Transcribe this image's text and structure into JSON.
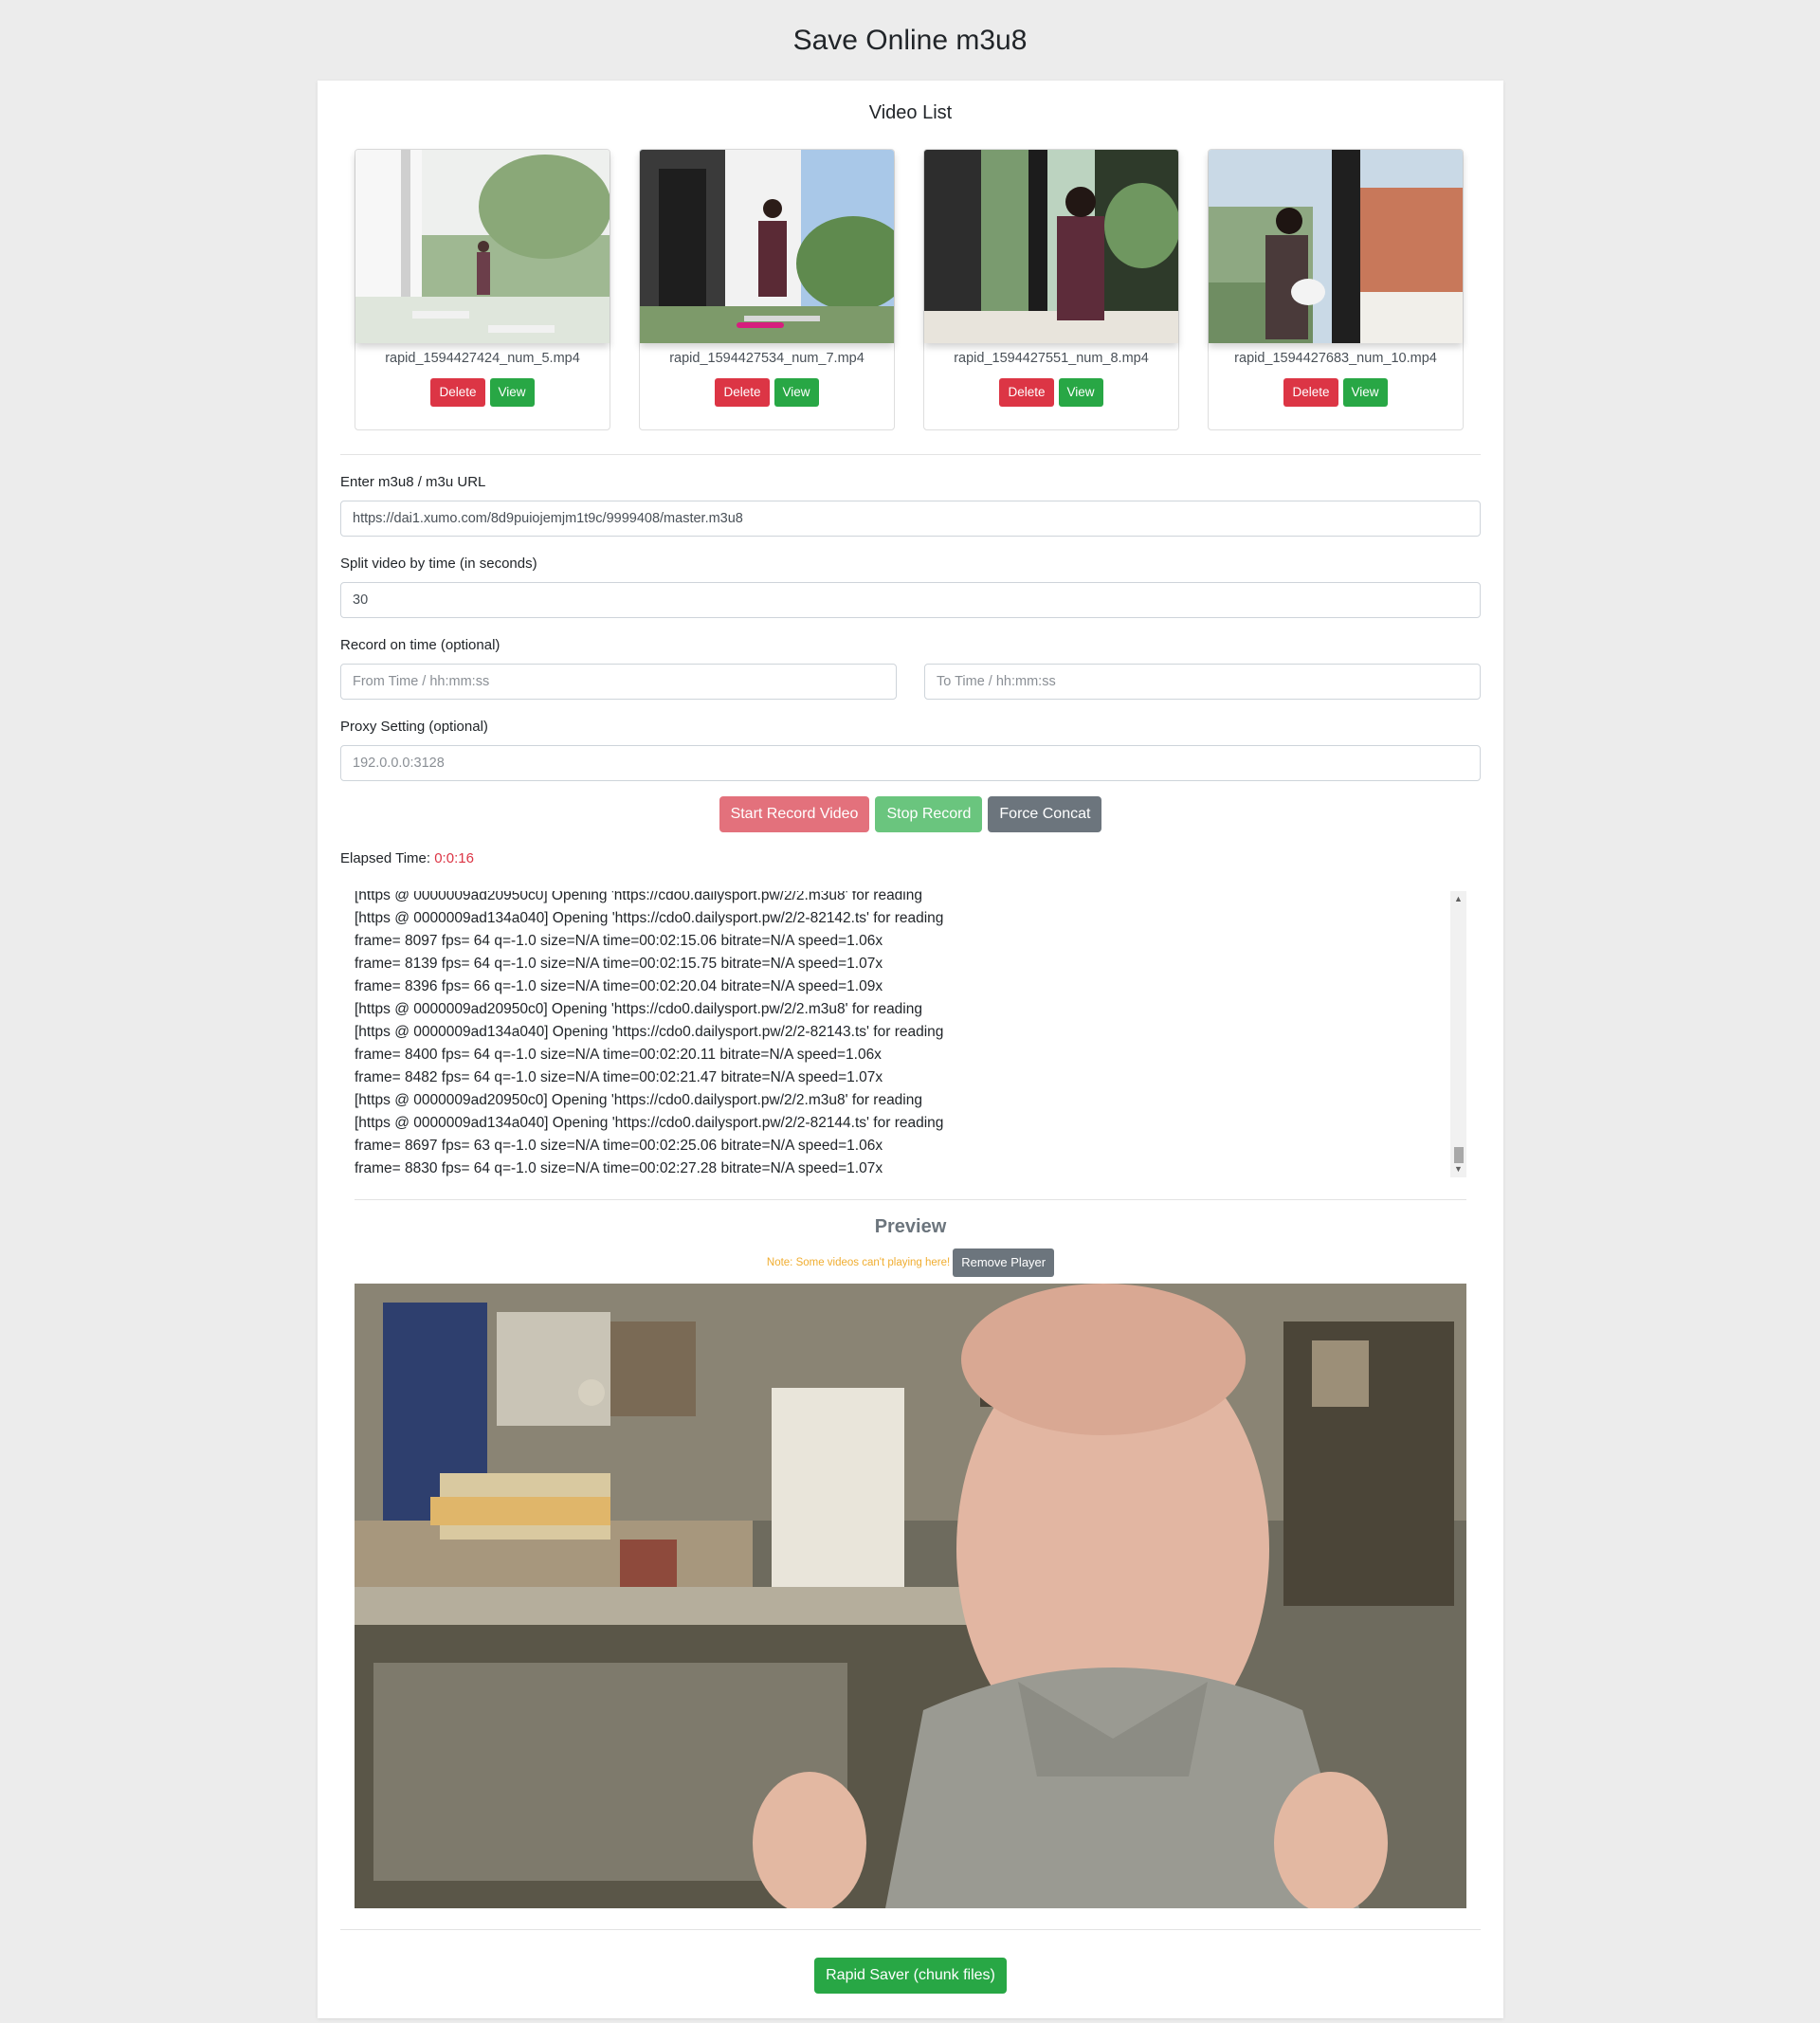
{
  "page_title": "Save Online m3u8",
  "video_list": {
    "title": "Video List",
    "items": [
      {
        "filename": "rapid_1594427424_num_5.mp4",
        "delete_label": "Delete",
        "view_label": "View"
      },
      {
        "filename": "rapid_1594427534_num_7.mp4",
        "delete_label": "Delete",
        "view_label": "View"
      },
      {
        "filename": "rapid_1594427551_num_8.mp4",
        "delete_label": "Delete",
        "view_label": "View"
      },
      {
        "filename": "rapid_1594427683_num_10.mp4",
        "delete_label": "Delete",
        "view_label": "View"
      }
    ]
  },
  "form": {
    "url_label": "Enter m3u8 / m3u URL",
    "url_value": "https://dai1.xumo.com/8d9puiojemjm1t9c/9999408/master.m3u8",
    "split_label": "Split video by time (in seconds)",
    "split_value": "30",
    "record_label": "Record on time (optional)",
    "from_placeholder": "From Time / hh:mm:ss",
    "to_placeholder": "To Time / hh:mm:ss",
    "proxy_label": "Proxy Setting (optional)",
    "proxy_placeholder": "192.0.0.0:3128"
  },
  "actions": {
    "start_label": "Start Record Video",
    "stop_label": "Stop Record",
    "concat_label": "Force Concat"
  },
  "elapsed": {
    "label": "Elapsed Time:",
    "value": "0:0:16"
  },
  "log_lines": [
    "[https @ 0000009ad20950c0] Opening 'https://cdo0.dailysport.pw/2/2.m3u8' for reading",
    "[https @ 0000009ad134a040] Opening 'https://cdo0.dailysport.pw/2/2-82142.ts' for reading",
    "frame= 8097 fps= 64 q=-1.0 size=N/A time=00:02:15.06 bitrate=N/A speed=1.06x",
    "frame= 8139 fps= 64 q=-1.0 size=N/A time=00:02:15.75 bitrate=N/A speed=1.07x",
    "frame= 8396 fps= 66 q=-1.0 size=N/A time=00:02:20.04 bitrate=N/A speed=1.09x",
    "[https @ 0000009ad20950c0] Opening 'https://cdo0.dailysport.pw/2/2.m3u8' for reading",
    "[https @ 0000009ad134a040] Opening 'https://cdo0.dailysport.pw/2/2-82143.ts' for reading",
    "frame= 8400 fps= 64 q=-1.0 size=N/A time=00:02:20.11 bitrate=N/A speed=1.06x",
    "frame= 8482 fps= 64 q=-1.0 size=N/A time=00:02:21.47 bitrate=N/A speed=1.07x",
    "[https @ 0000009ad20950c0] Opening 'https://cdo0.dailysport.pw/2/2.m3u8' for reading",
    "[https @ 0000009ad134a040] Opening 'https://cdo0.dailysport.pw/2/2-82144.ts' for reading",
    "frame= 8697 fps= 63 q=-1.0 size=N/A time=00:02:25.06 bitrate=N/A speed=1.06x",
    "frame= 8830 fps= 64 q=-1.0 size=N/A time=00:02:27.28 bitrate=N/A speed=1.07x"
  ],
  "preview": {
    "title": "Preview",
    "note": "Note: Some videos can't playing here!",
    "remove_label": "Remove Player"
  },
  "footer": {
    "rapid_label": "Rapid Saver (chunk files)"
  },
  "colors": {
    "danger": "#dc3545",
    "success": "#28a745",
    "secondary": "#6c757d",
    "note": "#f0ad30"
  }
}
